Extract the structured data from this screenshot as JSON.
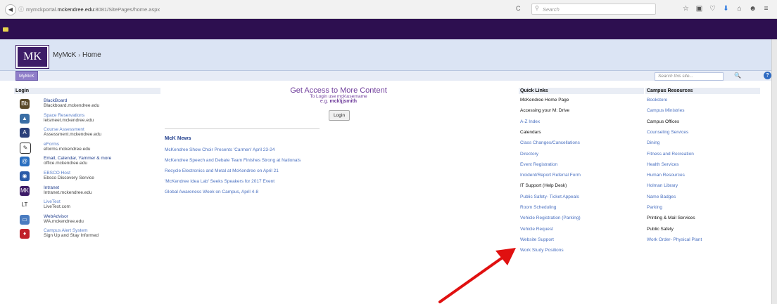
{
  "browser": {
    "back_glyph": "◀",
    "info_glyph": "ⓘ",
    "url_prefix": "mymckportal.",
    "url_domain": "mckendree.edu",
    "url_suffix": ":8081/SitePages/home.aspx",
    "reload_glyph": "C",
    "search_placeholder": "Search",
    "toolbar_icons": [
      "star-icon",
      "reading-list-icon",
      "pocket-icon",
      "download-icon",
      "home-icon",
      "account-icon",
      "menu-icon"
    ],
    "toolbar_glyphs": [
      "☆",
      "▣",
      "♡",
      "⬇",
      "⌂",
      "☻",
      "≡"
    ]
  },
  "site": {
    "logo_text": "MK",
    "title": "MyMcK",
    "breadcrumb_sep": "›",
    "page": "Home",
    "nav_tab": "MyMcK",
    "search_placeholder": "Search this site...",
    "search_go": "🔍",
    "help": "?"
  },
  "colors": {
    "suite_bar": "#2d0f50",
    "accent_purple": "#6f3d9b",
    "link_blue": "#4a70c0",
    "arrow_red": "#e01010"
  },
  "login": {
    "heading": "Login",
    "items": [
      {
        "name": "BlackBoard",
        "url": "Blackboard.mckendree.edu",
        "icon": "blackboard-icon"
      },
      {
        "name": "Space Reservations",
        "url": "letsmeet.mckendree.edu",
        "icon": "space-reservations-icon"
      },
      {
        "name": "Course Assessment",
        "url": "Assessment.mckendree.edu",
        "icon": "course-assessment-icon"
      },
      {
        "name": "eForms",
        "url": "eforms.mckendree.edu",
        "icon": "eforms-icon"
      },
      {
        "name": "Email, Calendar, Yammer & more",
        "url": "office.mckendree.edu",
        "icon": "email-icon"
      },
      {
        "name": "EBSCO Host",
        "url": "Ebsco Discovery Service",
        "icon": "ebsco-icon"
      },
      {
        "name": "Intranet",
        "url": "Intranet.mckendree.edu",
        "icon": "intranet-icon"
      },
      {
        "name": "LiveText",
        "url": "LiveText.com",
        "icon": "livetext-icon"
      },
      {
        "name": "WebAdvisor",
        "url": "WA.mckendree.edu",
        "icon": "webadvisor-icon"
      },
      {
        "name": "Campus Alert System",
        "url": "Sign Up and Stay Informed",
        "icon": "campus-alert-icon"
      }
    ]
  },
  "access": {
    "title": "Get Access to More Content",
    "sub": "To Login use mck\\username",
    "eg_prefix": "e.g. ",
    "eg_user": "mck\\jjsmith",
    "login_button": "Login"
  },
  "news": {
    "heading": "McK News",
    "items": [
      "McKendree Show Choir Presents 'Carmen' April 23-24",
      "McKendree Speech and Debate Team Finishes Strong at Nationals",
      "Recycle Electronics and Metal at McKendree on April 21",
      "'McKendree Idea Lab' Seeks Speakers for 2017 Event",
      "Global Awareness Week on Campus, April 4-8"
    ]
  },
  "quick_links": {
    "heading": "Quick Links",
    "items": [
      "McKendree Home Page",
      "Accessing your M: Drive",
      "A-Z Index",
      "Calendars",
      "Class Changes/Cancellations",
      "Directory",
      "Event Registration",
      "Incident/Report Referral Form",
      "IT Support (Help Desk)",
      "Public Safety- Ticket Appeals",
      "Room Scheduling",
      "Vehicle Registration (Parking)",
      "Vehicle Request",
      "Website Support",
      "Work Study Positions"
    ]
  },
  "campus_resources": {
    "heading": "Campus Resources",
    "items": [
      "Bookstore",
      "Campus Ministries",
      "Campus Offices",
      "Counseling Services",
      "Dining",
      "Fitness and Recreation",
      "Health Services",
      "Human Resources",
      "Holman Library",
      "Name Badges",
      "Parking",
      "Printing & Mail Services",
      "Public Safety",
      "Work Order- Physical Plant"
    ]
  }
}
